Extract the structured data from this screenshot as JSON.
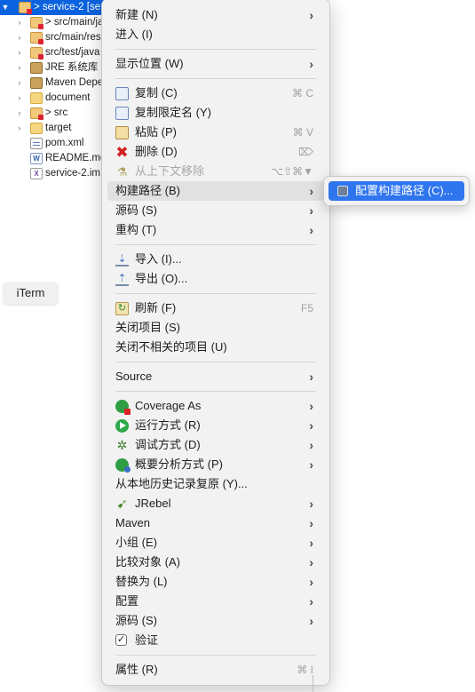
{
  "tree": {
    "items": [
      {
        "label": "> service-2 [se",
        "icon": "project-icon",
        "arrow": "chevron-down-icon",
        "selected": true
      },
      {
        "label": "> src/main/ja",
        "icon": "source-folder-icon",
        "arrow": "chevron-right-icon"
      },
      {
        "label": "src/main/res",
        "icon": "source-folder-icon",
        "arrow": "chevron-right-icon"
      },
      {
        "label": "src/test/java",
        "icon": "source-folder-icon",
        "arrow": "chevron-right-icon"
      },
      {
        "label": "JRE 系统库 [",
        "icon": "library-icon",
        "arrow": "chevron-right-icon"
      },
      {
        "label": "Maven Depe",
        "icon": "library-icon",
        "arrow": "chevron-right-icon"
      },
      {
        "label": "document",
        "icon": "folder-icon",
        "arrow": "chevron-right-icon"
      },
      {
        "label": "> src",
        "icon": "folder-icon",
        "arrow": "chevron-right-icon"
      },
      {
        "label": "target",
        "icon": "folder-icon",
        "arrow": "chevron-right-icon"
      },
      {
        "label": "pom.xml",
        "icon": "xml-file-icon",
        "arrow": ""
      },
      {
        "label": "README.md",
        "icon": "markdown-file-icon",
        "arrow": ""
      },
      {
        "label": "service-2.im",
        "icon": "iml-file-icon",
        "arrow": ""
      }
    ]
  },
  "iterm": {
    "label": "iTerm"
  },
  "menu": {
    "new": {
      "label": "新建 (N)"
    },
    "go_into": {
      "label": "进入 (I)"
    },
    "show_in": {
      "label": "显示位置 (W)"
    },
    "copy": {
      "label": "复制 (C)",
      "shortcut": "⌘ C"
    },
    "copy_qualified": {
      "label": "复制限定名 (Y)"
    },
    "paste": {
      "label": "粘贴 (P)",
      "shortcut": "⌘ V"
    },
    "delete": {
      "label": "删除 (D)",
      "shortcut": "⌦"
    },
    "remove_context": {
      "label": "从上下文移除",
      "shortcut": "⌥⇧⌘▼"
    },
    "build_path": {
      "label": "构建路径 (B)"
    },
    "source": {
      "label": "源码 (S)"
    },
    "refactor": {
      "label": "重构 (T)"
    },
    "import": {
      "label": "导入 (I)..."
    },
    "export": {
      "label": "导出 (O)..."
    },
    "refresh": {
      "label": "刷新 (F)",
      "shortcut": "F5"
    },
    "close_project": {
      "label": "关闭项目 (S)"
    },
    "close_unrelated": {
      "label": "关闭不相关的项目 (U)"
    },
    "source_en": {
      "label": "Source"
    },
    "coverage_as": {
      "label": "Coverage As"
    },
    "run_as": {
      "label": "运行方式 (R)"
    },
    "debug_as": {
      "label": "调试方式 (D)"
    },
    "profile_as": {
      "label": "概要分析方式 (P)"
    },
    "restore_history": {
      "label": "从本地历史记录复原 (Y)..."
    },
    "jrebel": {
      "label": "JRebel"
    },
    "maven": {
      "label": "Maven"
    },
    "team": {
      "label": "小组 (E)"
    },
    "compare_with": {
      "label": "比较对象 (A)"
    },
    "replace_with": {
      "label": "替换为 (L)"
    },
    "configure": {
      "label": "配置"
    },
    "source2": {
      "label": "源码 (S)"
    },
    "validate": {
      "label": "验证",
      "checked": true
    },
    "properties": {
      "label": "属性 (R)",
      "shortcut": "⌘ I"
    }
  },
  "submenu": {
    "configure_build_path": {
      "label": "配置构建路径 (C)..."
    }
  },
  "colors": {
    "selection": "#0a62de",
    "submenu_highlight": "#2f75ee",
    "menu_bg": "#f2f2f2"
  }
}
